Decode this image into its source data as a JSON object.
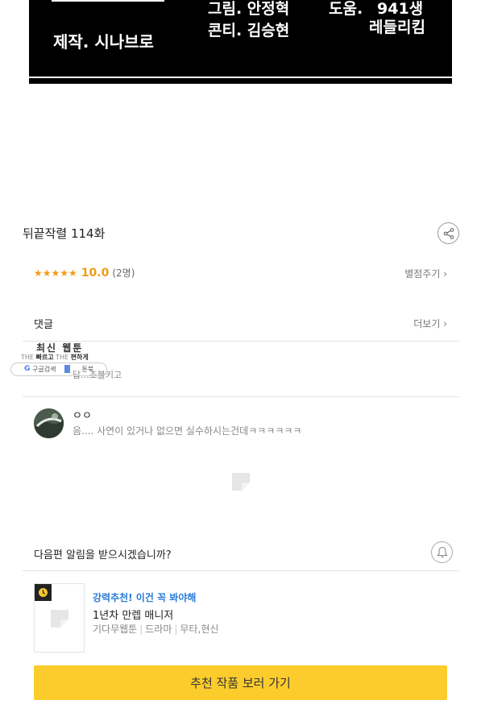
{
  "comic_credits": {
    "production": "제작. 시나브로",
    "art": "그림. 안정혁",
    "storyboard": "콘티. 김승현",
    "assist_label": "도움.",
    "assist_names_1": "941생",
    "assist_names_2": "레들리킴"
  },
  "episode": {
    "title": "뒤끝작렬 114화",
    "share_icon": "share-icon"
  },
  "rating": {
    "stars": "★★★★★",
    "score": "10.0",
    "count": "(2명)",
    "rate_link": "별점주기 ›"
  },
  "comments": {
    "heading": "댓글",
    "more_link": "더보기 ›",
    "latest_widget": {
      "title": "최신 웹툰",
      "tags": [
        "THE",
        "빠르고",
        "THE",
        "편하게"
      ],
      "google_label": "구글검색",
      "toon_label": "툰북"
    },
    "under_text": "답...조블키고",
    "items": [
      {
        "author": "ㅇㅇ",
        "text": "음.... 사연이 있거나 없으면 실수하시는건데ㅋㅋㅋㅋㅋㅋ"
      }
    ]
  },
  "notify": {
    "text": "다음편 알림을 받으시겠습니까?",
    "icon": "bell-icon"
  },
  "recommendation": {
    "tag": "강력추천! 이건 꼭 봐야해",
    "title": "1년차 만렙 매니저",
    "meta": [
      "기다무웹툰",
      "드라마",
      "무타,현신"
    ],
    "badge_icon": "clock-icon"
  },
  "cta": {
    "label": "추천 작품 보러 가기"
  },
  "colors": {
    "accent_star": "#f29b13",
    "link_blue": "#2b7bd6",
    "cta_yellow": "#fccc2c"
  }
}
